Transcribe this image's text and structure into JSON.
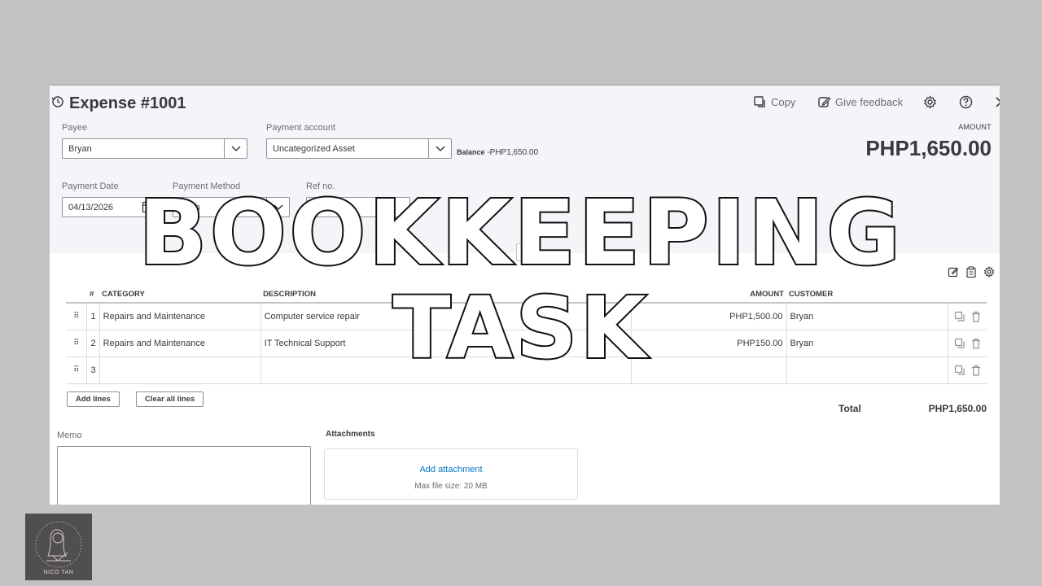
{
  "header": {
    "title": "Expense #1001",
    "copy_label": "Copy",
    "feedback_label": "Give feedback"
  },
  "payee": {
    "label": "Payee",
    "value": "Bryan"
  },
  "payment_account": {
    "label": "Payment account",
    "value": "Uncategorized Asset"
  },
  "balance": {
    "label": "Balance",
    "value": "-PHP1,650.00"
  },
  "amount": {
    "label": "AMOUNT",
    "value": "PHP1,650.00"
  },
  "payment_date": {
    "label": "Payment Date",
    "value": "04/13/2026"
  },
  "payment_method": {
    "label": "Payment Method",
    "value": "Cash"
  },
  "ref_no": {
    "label": "Ref no.",
    "value": "100"
  },
  "table": {
    "headers": {
      "index": "#",
      "category": "CATEGORY",
      "description": "DESCRIPTION",
      "amount": "AMOUNT",
      "customer": "CUSTOMER"
    },
    "rows": [
      {
        "index": "1",
        "category": "Repairs and Maintenance",
        "description": "Computer service repair",
        "amount": "PHP1,500.00",
        "customer": "Bryan"
      },
      {
        "index": "2",
        "category": "Repairs and Maintenance",
        "description": "IT Technical Support",
        "amount": "PHP150.00",
        "customer": "Bryan"
      },
      {
        "index": "3",
        "category": "",
        "description": "",
        "amount": "",
        "customer": ""
      }
    ]
  },
  "buttons": {
    "add_lines": "Add lines",
    "clear_lines": "Clear all lines"
  },
  "total": {
    "label": "Total",
    "value": "PHP1,650.00"
  },
  "memo": {
    "label": "Memo"
  },
  "attachments": {
    "label": "Attachments",
    "link": "Add attachment",
    "note": "Max file size: 20 MB"
  },
  "overlay": {
    "line1": "BOOKKEEPING",
    "line2": "TASK"
  },
  "logo": {
    "text": "NICO TAN"
  },
  "colors": {
    "link": "#0077c5",
    "panel": "#f4f5f8",
    "background": "#c3c3c3"
  }
}
